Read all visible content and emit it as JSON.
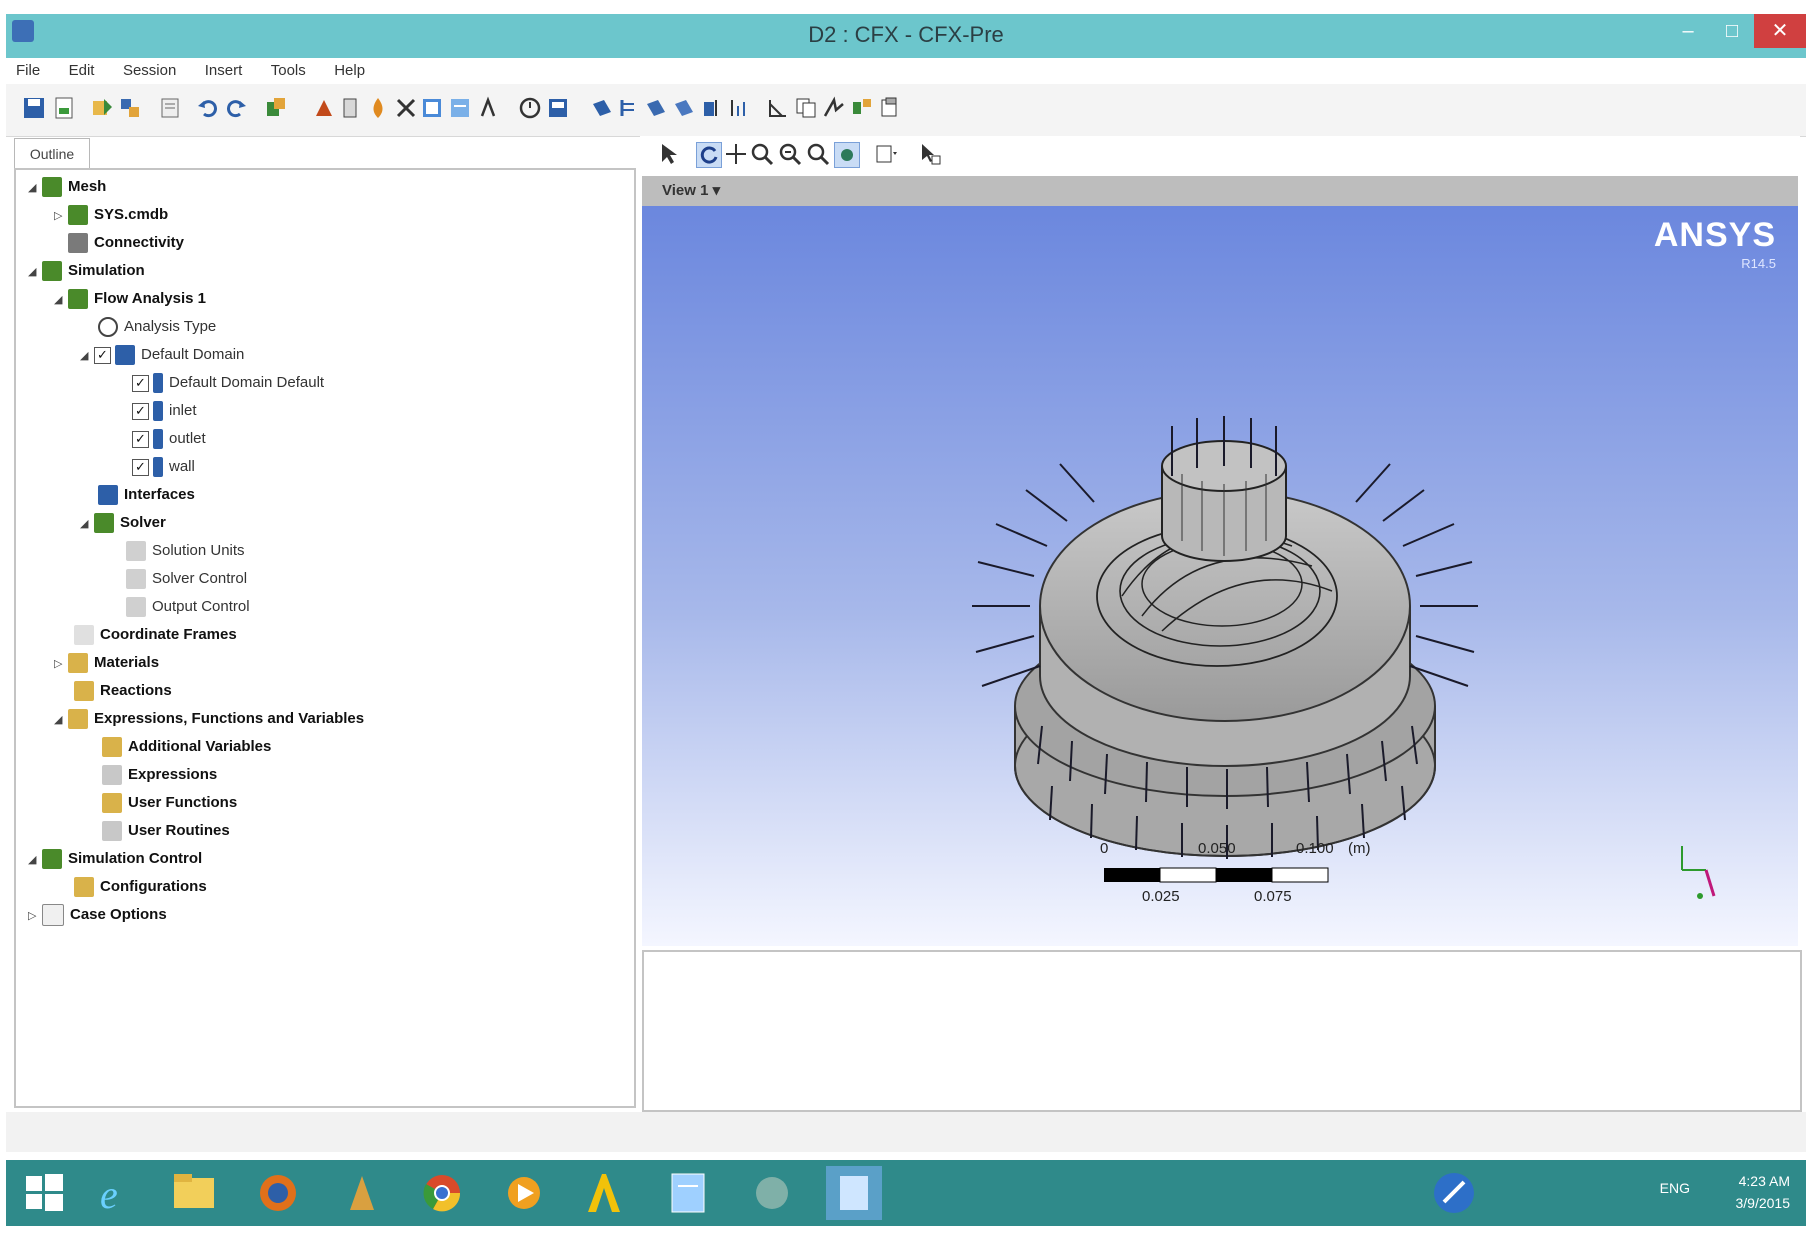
{
  "window": {
    "title": "D2 : CFX - CFX-Pre",
    "minimize": "–",
    "maximize": "□",
    "close": "✕"
  },
  "menu": [
    "File",
    "Edit",
    "Session",
    "Insert",
    "Tools",
    "Help"
  ],
  "outline": {
    "tab_label": "Outline",
    "items": [
      {
        "label": "Mesh",
        "level": 0,
        "expanded": true,
        "bold": true
      },
      {
        "label": "SYS.cmdb",
        "level": 1,
        "expanded": false,
        "bold": true
      },
      {
        "label": "Connectivity",
        "level": 1,
        "bold": true
      },
      {
        "label": "Simulation",
        "level": 0,
        "expanded": true,
        "bold": true
      },
      {
        "label": "Flow Analysis 1",
        "level": 1,
        "expanded": true,
        "bold": true
      },
      {
        "label": "Analysis Type",
        "level": 2,
        "bold": false
      },
      {
        "label": "Default Domain",
        "level": 2,
        "expanded": true,
        "checked": true,
        "bold": false
      },
      {
        "label": "Default Domain Default",
        "level": 3,
        "checked": true,
        "bold": false
      },
      {
        "label": "inlet",
        "level": 3,
        "checked": true,
        "bold": false
      },
      {
        "label": "outlet",
        "level": 3,
        "checked": true,
        "bold": false
      },
      {
        "label": "wall",
        "level": 3,
        "checked": true,
        "bold": false
      },
      {
        "label": "Interfaces",
        "level": 2,
        "bold": true
      },
      {
        "label": "Solver",
        "level": 2,
        "expanded": true,
        "bold": true
      },
      {
        "label": "Solution Units",
        "level": 3,
        "bold": false
      },
      {
        "label": "Solver Control",
        "level": 3,
        "bold": false
      },
      {
        "label": "Output Control",
        "level": 3,
        "bold": false
      },
      {
        "label": "Coordinate Frames",
        "level": 1,
        "bold": true
      },
      {
        "label": "Materials",
        "level": 1,
        "expanded": false,
        "bold": true
      },
      {
        "label": "Reactions",
        "level": 1,
        "bold": true
      },
      {
        "label": "Expressions, Functions and Variables",
        "level": 1,
        "expanded": true,
        "bold": true
      },
      {
        "label": "Additional Variables",
        "level": 2,
        "bold": true
      },
      {
        "label": "Expressions",
        "level": 2,
        "bold": true
      },
      {
        "label": "User Functions",
        "level": 2,
        "bold": true
      },
      {
        "label": "User Routines",
        "level": 2,
        "bold": true
      },
      {
        "label": "Simulation Control",
        "level": 0,
        "expanded": true,
        "bold": true
      },
      {
        "label": "Configurations",
        "level": 1,
        "bold": true
      },
      {
        "label": "Case Options",
        "level": 0,
        "expanded": false,
        "bold": true
      }
    ]
  },
  "viewer": {
    "view_label": "View 1",
    "logo": "ANSYS",
    "version": "R14.5",
    "scale": {
      "top_labels": [
        "0",
        "0.050",
        "0.100"
      ],
      "unit": "(m)",
      "bottom_labels": [
        "0.025",
        "0.075"
      ]
    }
  },
  "taskbar": {
    "language": "ENG",
    "time": "4:23 AM",
    "date": "3/9/2015"
  },
  "colors": {
    "titlebar": "#6cc6cc",
    "taskbar": "#2f8a8a",
    "viewport_top": "#6b87de",
    "viewport_bottom": "#f4f6ff"
  }
}
